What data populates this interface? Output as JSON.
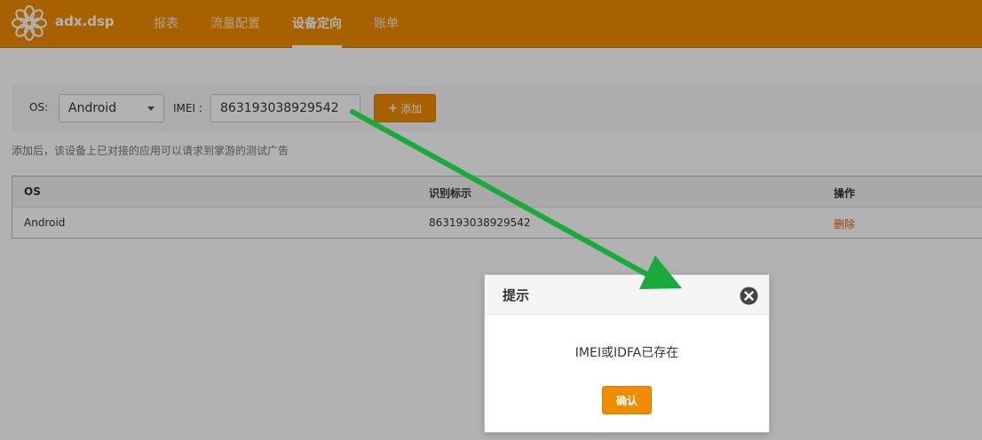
{
  "header": {
    "brand": "adx.dsp",
    "nav": [
      "报表",
      "流量配置",
      "设备定向",
      "账单"
    ],
    "active_index": 2
  },
  "filter": {
    "os_label": "OS:",
    "os_value": "Android",
    "imei_label": "IMEI :",
    "imei_value": "863193038929542",
    "add_label": "添加",
    "hint": "添加后，该设备上已对接的应用可以请求到掌游的测试广告"
  },
  "table": {
    "columns": [
      "OS",
      "识别标示",
      "操作"
    ],
    "rows": [
      {
        "os": "Android",
        "id": "863193038929542",
        "action": "删除"
      }
    ]
  },
  "dialog": {
    "title": "提示",
    "message": "IMEI或IDFA已存在",
    "confirm_label": "确认"
  },
  "icons": {
    "logo": "logo-icon",
    "close": "close-icon",
    "plus": "plus-icon",
    "caret": "caret-down-icon",
    "annotation": "annotation-arrow"
  },
  "colors": {
    "accent": "#f08c00",
    "delete": "#e0581c",
    "arrow": "#1aaa3c"
  }
}
